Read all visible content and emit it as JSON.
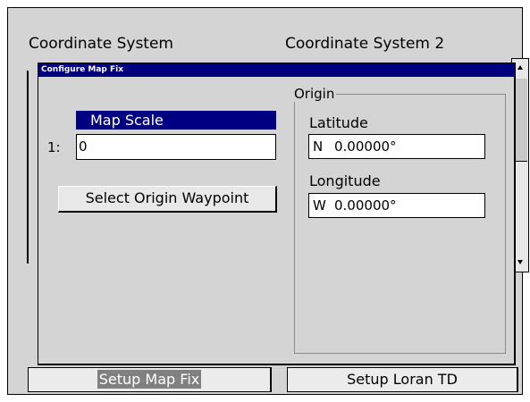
{
  "background": {
    "coordinate_system_label": "Coordinate System",
    "coordinate_system_2_label": "Coordinate System 2",
    "tabs": {
      "setup_map_fix": "Setup Map Fix",
      "setup_loran_td": "Setup Loran TD"
    }
  },
  "dialog": {
    "title": "Configure Map Fix",
    "map_scale": {
      "header": "Map Scale",
      "prefix": "1:",
      "value": "0"
    },
    "select_origin_button": "Select Origin Waypoint",
    "origin": {
      "legend": "Origin",
      "latitude_label": "Latitude",
      "latitude_dir": "N",
      "latitude_value": "0.00000°",
      "longitude_label": "Longitude",
      "longitude_dir": "W",
      "longitude_value": "0.00000°"
    }
  },
  "colors": {
    "title_bar": "#000080",
    "selected_tab": "#808080",
    "panel": "#d4d4d4"
  }
}
